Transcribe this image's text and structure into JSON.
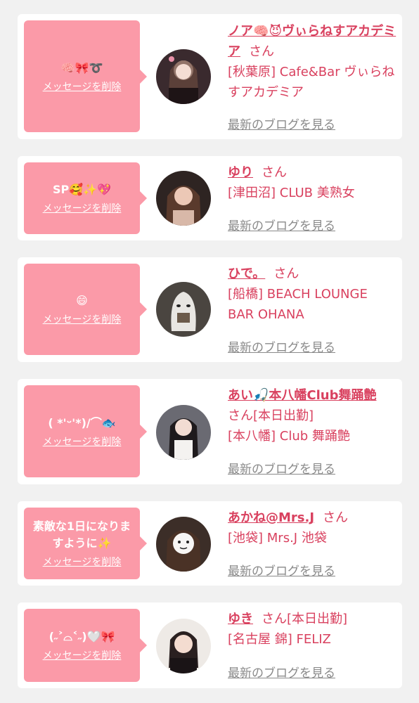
{
  "delete_label": "メッセージを削除",
  "blog_label": "最新のブログを見る",
  "san_label": "さん",
  "accent_color": "#d9415f",
  "bubble_color": "#fb9aa8",
  "items": [
    {
      "message": "🧠🎀➰",
      "name": "ノア🧠😈ヴぃらねすアカデミア",
      "status": "",
      "shop": "[秋葉原] Cafe&Bar ヴぃらねすアカデミア"
    },
    {
      "message": "SP🥰✨💖",
      "name": "ゆり",
      "status": "",
      "shop": "[津田沼] CLUB 美熟女"
    },
    {
      "message": "😄",
      "name": "ひで。",
      "status": "",
      "shop": "[船橋] BEACH LOUNGE BAR OHANA"
    },
    {
      "message": "( *'ᵕ'*)/⌒🐟",
      "name": "あい🎣本八幡Club舞踊艶",
      "status": "[本日出勤]",
      "shop": "[本八幡] Club 舞踊艶"
    },
    {
      "message": "素敵な1日になりますように✨",
      "name": "あかね@Mrs.J",
      "status": "",
      "shop": "[池袋] Mrs.J 池袋"
    },
    {
      "message": "(˶˃⌓˂˶)🤍🎀",
      "name": "ゆき",
      "status": "[本日出勤]",
      "shop": "[名古屋 錦] FELIZ"
    }
  ]
}
